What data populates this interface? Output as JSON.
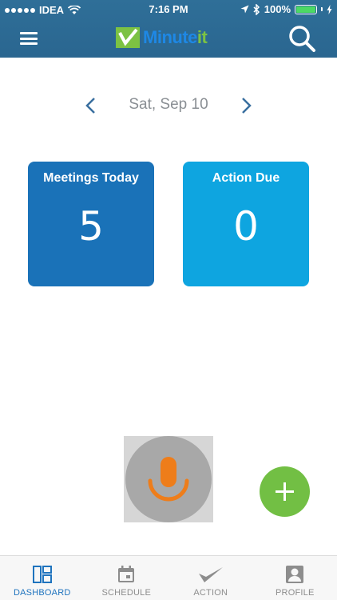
{
  "status_bar": {
    "carrier": "IDEA",
    "time": "7:16 PM",
    "battery": "100%"
  },
  "nav": {
    "logo_prefix": "Minute",
    "logo_suffix": "it"
  },
  "date_selector": {
    "label": "Sat, Sep 10"
  },
  "cards": [
    {
      "title": "Meetings Today",
      "count": "5",
      "color": "#1a72b8"
    },
    {
      "title": "Action Due",
      "count": "0",
      "color": "#0ea5e0"
    }
  ],
  "tabs": [
    {
      "label": "DASHBOARD",
      "icon": "dashboard-icon",
      "active": true
    },
    {
      "label": "SCHEDULE",
      "icon": "calendar-icon",
      "active": false
    },
    {
      "label": "ACTION",
      "icon": "checkmark-icon",
      "active": false
    },
    {
      "label": "PROFILE",
      "icon": "profile-icon",
      "active": false
    }
  ],
  "colors": {
    "header": "#2a6690",
    "accent": "#1e73be",
    "fab": "#72bf44",
    "mic": "#ee7d1a"
  }
}
